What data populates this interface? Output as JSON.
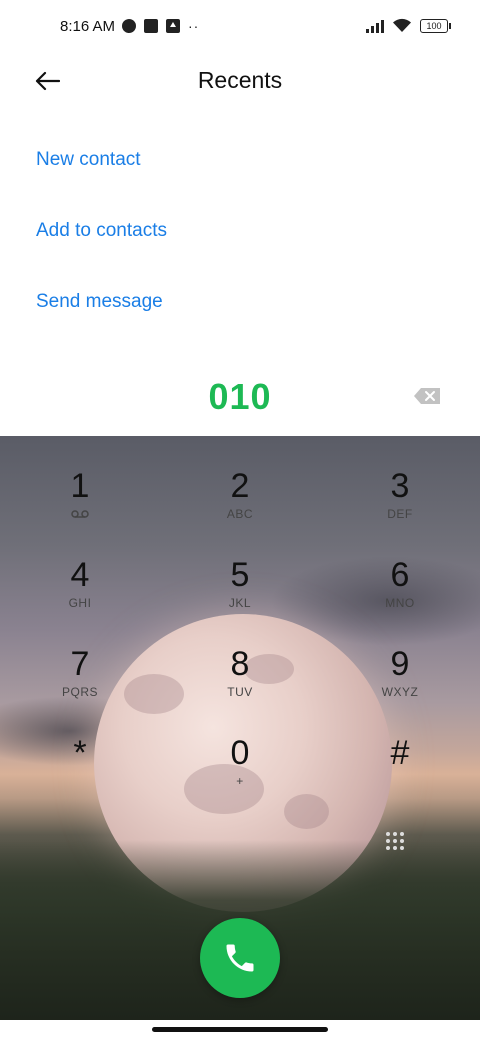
{
  "status_bar": {
    "time": "8:16 AM",
    "battery": "100",
    "icons": [
      "app-icon",
      "square-icon",
      "upload-icon",
      "more-dots-icon",
      "signal-icon",
      "wifi-icon",
      "battery-icon"
    ]
  },
  "header": {
    "title": "Recents",
    "back_icon": "arrow-left-icon"
  },
  "actions": [
    {
      "label": "New contact"
    },
    {
      "label": "Add to contacts"
    },
    {
      "label": "Send message"
    }
  ],
  "dialer": {
    "number": "010",
    "keys": [
      {
        "digit": "1",
        "letters": "",
        "icon": "voicemail-icon"
      },
      {
        "digit": "2",
        "letters": "ABC"
      },
      {
        "digit": "3",
        "letters": "DEF"
      },
      {
        "digit": "4",
        "letters": "GHI"
      },
      {
        "digit": "5",
        "letters": "JKL"
      },
      {
        "digit": "6",
        "letters": "MNO"
      },
      {
        "digit": "7",
        "letters": "PQRS"
      },
      {
        "digit": "8",
        "letters": "TUV"
      },
      {
        "digit": "9",
        "letters": "WXYZ"
      },
      {
        "digit": "*",
        "letters": ""
      },
      {
        "digit": "0",
        "letters": "+"
      },
      {
        "digit": "#",
        "letters": ""
      }
    ],
    "call_icon": "phone-icon"
  },
  "colors": {
    "accent_blue": "#1a7ee6",
    "number_green": "#1db954",
    "call_green": "#1db954"
  }
}
